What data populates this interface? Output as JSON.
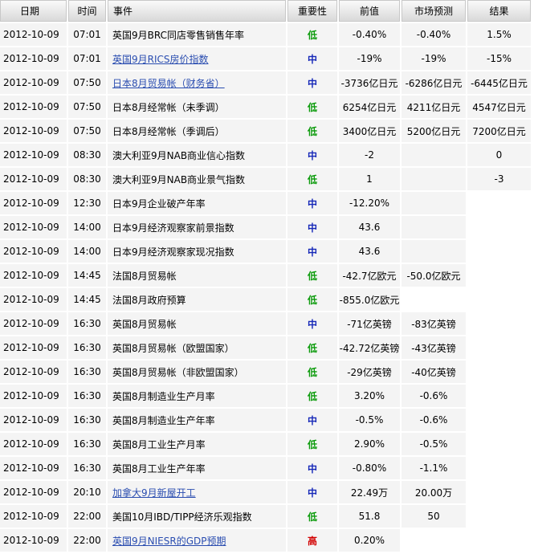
{
  "headers": {
    "date": "日期",
    "time": "时间",
    "event": "事件",
    "importance": "重要性",
    "previous": "前值",
    "forecast": "市场预测",
    "actual": "结果"
  },
  "importance_colors": {
    "低": "#0a9a0a",
    "中": "#1628b8",
    "高": "#d20000"
  },
  "rows": [
    {
      "date": "2012-10-09",
      "time": "07:01",
      "event": "英国9月BRC同店零售销售年率",
      "link": false,
      "importance": "低",
      "previous": "-0.40%",
      "forecast": "-0.40%",
      "actual": "1.5%"
    },
    {
      "date": "2012-10-09",
      "time": "07:01",
      "event": "英国9月RICS房价指数",
      "link": true,
      "importance": "中",
      "previous": "-19%",
      "forecast": "-19%",
      "actual": "-15%"
    },
    {
      "date": "2012-10-09",
      "time": "07:50",
      "event": "日本8月贸易帐（财务省）",
      "link": true,
      "importance": "中",
      "previous": "-3736亿日元",
      "forecast": "-6286亿日元",
      "actual": "-6445亿日元"
    },
    {
      "date": "2012-10-09",
      "time": "07:50",
      "event": "日本8月经常帐（未季调）",
      "link": false,
      "importance": "低",
      "previous": "6254亿日元",
      "forecast": "4211亿日元",
      "actual": "4547亿日元"
    },
    {
      "date": "2012-10-09",
      "time": "07:50",
      "event": "日本8月经常帐（季调后）",
      "link": false,
      "importance": "低",
      "previous": "3400亿日元",
      "forecast": "5200亿日元",
      "actual": "7200亿日元"
    },
    {
      "date": "2012-10-09",
      "time": "08:30",
      "event": "澳大利亚9月NAB商业信心指数",
      "link": false,
      "importance": "中",
      "previous": "-2",
      "forecast": "",
      "actual": "0"
    },
    {
      "date": "2012-10-09",
      "time": "08:30",
      "event": "澳大利亚9月NAB商业景气指数",
      "link": false,
      "importance": "低",
      "previous": "1",
      "forecast": "",
      "actual": "-3"
    },
    {
      "date": "2012-10-09",
      "time": "12:30",
      "event": "日本9月企业破产年率",
      "link": false,
      "importance": "中",
      "previous": "-12.20%",
      "forecast": "",
      "actual": null
    },
    {
      "date": "2012-10-09",
      "time": "14:00",
      "event": "日本9月经济观察家前景指数",
      "link": false,
      "importance": "中",
      "previous": "43.6",
      "forecast": "",
      "actual": null
    },
    {
      "date": "2012-10-09",
      "time": "14:00",
      "event": "日本9月经济观察家现况指数",
      "link": false,
      "importance": "中",
      "previous": "43.6",
      "forecast": "",
      "actual": null
    },
    {
      "date": "2012-10-09",
      "time": "14:45",
      "event": "法国8月贸易帐",
      "link": false,
      "importance": "低",
      "previous": "-42.7亿欧元",
      "forecast": "-50.0亿欧元",
      "actual": null
    },
    {
      "date": "2012-10-09",
      "time": "14:45",
      "event": "法国8月政府预算",
      "link": false,
      "importance": "低",
      "previous": "-855.0亿欧元",
      "forecast": null,
      "actual": null
    },
    {
      "date": "2012-10-09",
      "time": "16:30",
      "event": "英国8月贸易帐",
      "link": false,
      "importance": "中",
      "previous": "-71亿英镑",
      "forecast": "-83亿英镑",
      "actual": null
    },
    {
      "date": "2012-10-09",
      "time": "16:30",
      "event": "英国8月贸易帐（欧盟国家）",
      "link": false,
      "importance": "低",
      "previous": "-42.72亿英镑",
      "forecast": "-43亿英镑",
      "actual": null
    },
    {
      "date": "2012-10-09",
      "time": "16:30",
      "event": "英国8月贸易帐（非欧盟国家）",
      "link": false,
      "importance": "低",
      "previous": "-29亿英镑",
      "forecast": "-40亿英镑",
      "actual": null
    },
    {
      "date": "2012-10-09",
      "time": "16:30",
      "event": "英国8月制造业生产月率",
      "link": false,
      "importance": "低",
      "previous": "3.20%",
      "forecast": "-0.6%",
      "actual": null
    },
    {
      "date": "2012-10-09",
      "time": "16:30",
      "event": "英国8月制造业生产年率",
      "link": false,
      "importance": "中",
      "previous": "-0.5%",
      "forecast": "-0.6%",
      "actual": null
    },
    {
      "date": "2012-10-09",
      "time": "16:30",
      "event": "英国8月工业生产月率",
      "link": false,
      "importance": "低",
      "previous": "2.90%",
      "forecast": "-0.5%",
      "actual": null
    },
    {
      "date": "2012-10-09",
      "time": "16:30",
      "event": "英国8月工业生产年率",
      "link": false,
      "importance": "中",
      "previous": "-0.80%",
      "forecast": "-1.1%",
      "actual": null
    },
    {
      "date": "2012-10-09",
      "time": "20:10",
      "event": "加拿大9月新屋开工",
      "link": true,
      "importance": "中",
      "previous": "22.49万",
      "forecast": "20.00万",
      "actual": null
    },
    {
      "date": "2012-10-09",
      "time": "22:00",
      "event": "美国10月IBD/TIPP经济乐观指数",
      "link": false,
      "importance": "低",
      "previous": "51.8",
      "forecast": "50",
      "actual": null
    },
    {
      "date": "2012-10-09",
      "time": "22:00",
      "event": "英国9月NIESR的GDP预期",
      "link": true,
      "importance": "高",
      "previous": "0.20%",
      "forecast": null,
      "actual": null
    }
  ]
}
